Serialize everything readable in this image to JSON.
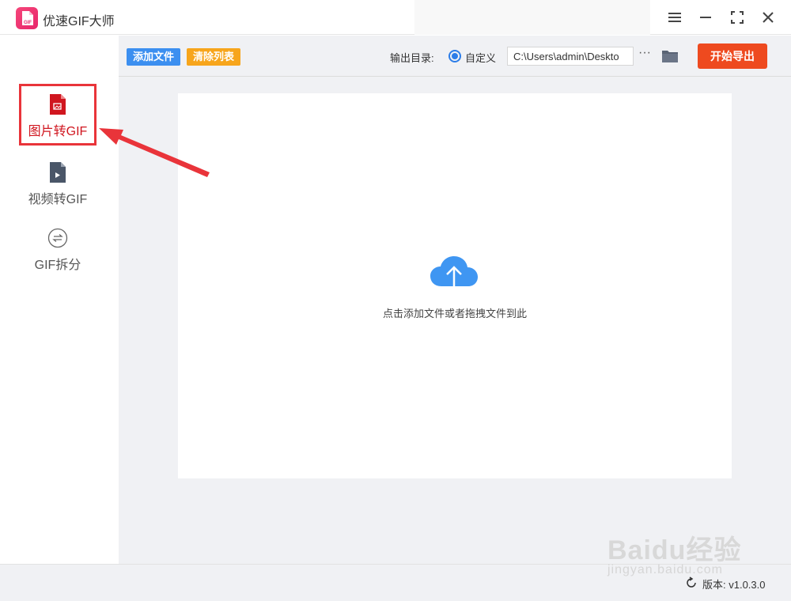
{
  "app": {
    "title": "优速GIF大师",
    "logo_text": "GIF"
  },
  "window_controls": {
    "menu_icon": "menu-icon",
    "minimize_icon": "minimize-icon",
    "maximize_icon": "maximize-icon",
    "close_icon": "close-icon"
  },
  "sidebar": {
    "items": [
      {
        "label": "图片转GIF",
        "icon": "image-file-icon",
        "active": true
      },
      {
        "label": "视频转GIF",
        "icon": "video-file-icon",
        "active": false
      },
      {
        "label": "GIF拆分",
        "icon": "split-icon",
        "active": false
      }
    ]
  },
  "toolbar": {
    "add_files_label": "添加文件",
    "clear_list_label": "清除列表",
    "output_dir_label": "输出目录:",
    "custom_option_label": "自定义",
    "output_path_value": "C:\\Users\\admin\\Deskto",
    "more_label": "···",
    "start_export_label": "开始导出"
  },
  "drop_area": {
    "hint": "点击添加文件或者拖拽文件到此"
  },
  "status": {
    "version_text": "版本: v1.0.3.0"
  },
  "watermark": {
    "text": "Baidu经验",
    "sub": "jingyan.baidu.com"
  },
  "colors": {
    "accent_blue": "#3c8ff0",
    "accent_orange": "#f7a51c",
    "start_red": "#ee4a1f",
    "active_red": "#d0161f",
    "highlight_border": "#e9343a",
    "cloud_blue": "#3f96f2"
  }
}
